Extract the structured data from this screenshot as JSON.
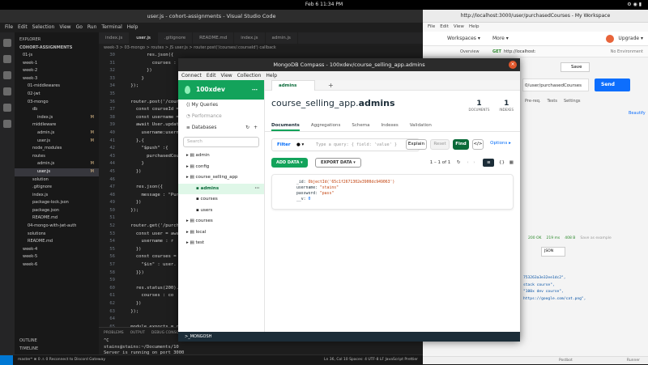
{
  "system": {
    "clock": "Feb 6  11:34 PM"
  },
  "vscode": {
    "title": "user.js - cohort-assignments - Visual Studio Code",
    "menu": [
      "File",
      "Edit",
      "Selection",
      "View",
      "Go",
      "Run",
      "Terminal",
      "Help"
    ],
    "explorer_header": "EXPLORER",
    "root": "COHORT-ASSIGNMENTS",
    "tree": [
      {
        "label": "01-js",
        "indent": 1,
        "mod": ""
      },
      {
        "label": "week-1",
        "indent": 1,
        "mod": ""
      },
      {
        "label": "week-2",
        "indent": 1,
        "mod": ""
      },
      {
        "label": "week-3",
        "indent": 1,
        "mod": ""
      },
      {
        "label": "01-middlewares",
        "indent": 2,
        "mod": ""
      },
      {
        "label": "02-jwt",
        "indent": 2,
        "mod": ""
      },
      {
        "label": "03-mongo",
        "indent": 2,
        "mod": ""
      },
      {
        "label": "db",
        "indent": 3,
        "mod": ""
      },
      {
        "label": "index.js",
        "indent": 4,
        "mod": "M"
      },
      {
        "label": "middleware",
        "indent": 3,
        "mod": ""
      },
      {
        "label": "admin.js",
        "indent": 4,
        "mod": "M"
      },
      {
        "label": "user.js",
        "indent": 4,
        "mod": "M"
      },
      {
        "label": "node_modules",
        "indent": 3,
        "mod": ""
      },
      {
        "label": "routes",
        "indent": 3,
        "mod": ""
      },
      {
        "label": "admin.js",
        "indent": 4,
        "mod": "M"
      },
      {
        "label": "user.js",
        "indent": 4,
        "mod": "M",
        "active": true
      },
      {
        "label": "solution",
        "indent": 3,
        "mod": ""
      },
      {
        "label": ".gitignore",
        "indent": 3,
        "mod": ""
      },
      {
        "label": "index.js",
        "indent": 3,
        "mod": ""
      },
      {
        "label": "package-lock.json",
        "indent": 3,
        "mod": ""
      },
      {
        "label": "package.json",
        "indent": 3,
        "mod": ""
      },
      {
        "label": "README.md",
        "indent": 3,
        "mod": ""
      },
      {
        "label": "04-mongo-with-jwt-auth",
        "indent": 2,
        "mod": ""
      },
      {
        "label": "solutions",
        "indent": 2,
        "mod": ""
      },
      {
        "label": "README.md",
        "indent": 2,
        "mod": ""
      },
      {
        "label": "week-4",
        "indent": 1,
        "mod": ""
      },
      {
        "label": "week-5",
        "indent": 1,
        "mod": ""
      },
      {
        "label": "week-6",
        "indent": 1,
        "mod": ""
      }
    ],
    "outline": "OUTLINE",
    "timeline": "TIMELINE",
    "tabs": [
      "index.js",
      "user.js",
      ".gitignore",
      "README.md",
      "index.js",
      "admin.js"
    ],
    "active_tab": 1,
    "breadcrumb": "week-3 > 03-mongo > routes > JS user.js > router.post('/courses/:courseId') callback",
    "code": [
      {
        "n": "30",
        "t": "          res.json({"
      },
      {
        "n": "31",
        "t": "            courses : allCourses"
      },
      {
        "n": "32",
        "t": "          })"
      },
      {
        "n": "33",
        "t": "        }"
      },
      {
        "n": "34",
        "t": "    });"
      },
      {
        "n": "35",
        "t": ""
      },
      {
        "n": "36",
        "t": "    router.post('/courses"
      },
      {
        "n": "37",
        "t": "      const courseId = r"
      },
      {
        "n": "38",
        "t": "      const username = r"
      },
      {
        "n": "39",
        "t": "      await User.updateO"
      },
      {
        "n": "40",
        "t": "        username:username"
      },
      {
        "n": "41",
        "t": "      },{"
      },
      {
        "n": "42",
        "t": "        \"$push\" :{"
      },
      {
        "n": "43",
        "t": "          purchasedCour"
      },
      {
        "n": "44",
        "t": "        }"
      },
      {
        "n": "45",
        "t": "      })"
      },
      {
        "n": "46",
        "t": ""
      },
      {
        "n": "47",
        "t": "      res.json({"
      },
      {
        "n": "48",
        "t": "        message : \"Purch"
      },
      {
        "n": "49",
        "t": "      })"
      },
      {
        "n": "50",
        "t": "    });"
      },
      {
        "n": "51",
        "t": ""
      },
      {
        "n": "52",
        "t": "    router.get('/purchased"
      },
      {
        "n": "53",
        "t": "      const user = awai"
      },
      {
        "n": "54",
        "t": "        username : r"
      },
      {
        "n": "55",
        "t": "      })"
      },
      {
        "n": "56",
        "t": "      const courses = a"
      },
      {
        "n": "57",
        "t": "        \"$in\" : user."
      },
      {
        "n": "58",
        "t": "      }})"
      },
      {
        "n": "59",
        "t": ""
      },
      {
        "n": "60",
        "t": "      res.status(200)."
      },
      {
        "n": "61",
        "t": "        courses : co"
      },
      {
        "n": "62",
        "t": "      })"
      },
      {
        "n": "63",
        "t": "    });"
      },
      {
        "n": "64",
        "t": ""
      },
      {
        "n": "65",
        "t": "    module.exports = rout"
      }
    ],
    "panel_tabs": [
      "PROBLEMS",
      "OUTPUT",
      "DEBUG CONSOLE"
    ],
    "terminal": [
      "^C",
      "stains@stains:~/Documents/10",
      "Server is running on port 3000"
    ],
    "status_left": "master*   ⊗ 0 ⚠ 0   Reconnect to Discord Gateway",
    "status_right": "Ln 36, Col 10   Spaces: 4   UTF-8   LF   JavaScript   Prettier"
  },
  "postman": {
    "title": "http://localhost:3000/user/purchasedCourses - My Workspace",
    "menu": [
      "File",
      "Edit",
      "View",
      "Help"
    ],
    "workspaces": "Workspaces ▾",
    "more": "More ▾",
    "upgrade": "Upgrade ▾",
    "overview_tab": "Overview",
    "request_tab_method": "GET",
    "request_tab_url": "http://localhost:",
    "environment": "No Environment",
    "save": "Save",
    "url_value": "0/user/purchasedCourses",
    "send": "Send",
    "subtabs": [
      "Pre-req.",
      "Tests",
      "Settings"
    ],
    "beautify": "Beautify",
    "response_status": [
      "200 OK",
      "219 ms",
      "408 B",
      "Save as example"
    ],
    "format": "JSON",
    "body_lines": [
      "753263a3e32ee1dc2\",",
      "stack course\",",
      "\"100x dev course\",",
      "https://google.com/cat.png\","
    ],
    "bottom_runner": "Runner",
    "bottom_postbot": "Postbot"
  },
  "compass": {
    "title": "MongoDB Compass - 100xdev/course_selling_app.admins",
    "menu": [
      "Connect",
      "Edit",
      "View",
      "Collection",
      "Help"
    ],
    "connection": "100xdev",
    "nav": [
      "My Queries",
      "Performance",
      "Databases"
    ],
    "search_placeholder": "Search",
    "databases": [
      {
        "name": "admin",
        "level": 0
      },
      {
        "name": "config",
        "level": 0
      },
      {
        "name": "course_selling_app",
        "level": 0
      },
      {
        "name": "admins",
        "level": 1,
        "selected": true
      },
      {
        "name": "courses",
        "level": 1
      },
      {
        "name": "users",
        "level": 1
      },
      {
        "name": "courses",
        "level": 0
      },
      {
        "name": "local",
        "level": 0
      },
      {
        "name": "test",
        "level": 0
      }
    ],
    "tab_label": "admins",
    "namespace_db": "course_selling_app.",
    "namespace_coll": "admins",
    "documents_count": "1",
    "documents_label": "DOCUMENTS",
    "indexes_count": "1",
    "indexes_label": "INDEXES",
    "subtabs": [
      "Documents",
      "Aggregations",
      "Schema",
      "Indexes",
      "Validation"
    ],
    "filter_label": "Filter",
    "filter_placeholder": "Type a query: { field: 'value' }",
    "explain": "Explain",
    "reset": "Reset",
    "find": "Find",
    "options": "Options ▸",
    "add_data": "ADD DATA ▾",
    "export_data": "EXPORT DATA ▾",
    "pager": "1 – 1 of 1",
    "doc": {
      "id_key": "_id:",
      "id_val": "ObjectId('65c1f2671302e3900dc949063')",
      "username_key": "username:",
      "username_val": "\"stains\"",
      "password_key": "password:",
      "password_val": "\"pass\"",
      "v_key": "__v:",
      "v_val": "0"
    },
    "shell": ">_MONGOSH",
    "accent": "#13a35b"
  }
}
